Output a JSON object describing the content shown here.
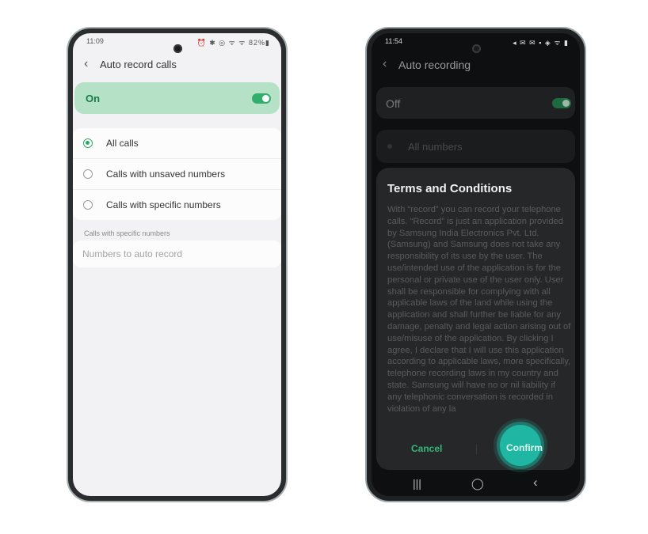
{
  "left_phone": {
    "status": {
      "time": "11:09",
      "icons": "⏰ ✱ ◎ ᯤ ᯤ 82%▮"
    },
    "title": "Auto record calls",
    "master_toggle": {
      "label": "On",
      "state": "on",
      "color": "#2faf6b"
    },
    "options": [
      {
        "label": "All calls",
        "selected": true
      },
      {
        "label": "Calls with unsaved numbers",
        "selected": false
      },
      {
        "label": "Calls with specific numbers",
        "selected": false
      }
    ],
    "section_header": "Calls with specific numbers",
    "numbers_field": {
      "placeholder": "Numbers to auto record",
      "value": ""
    }
  },
  "right_phone": {
    "status": {
      "time": "11:54",
      "icons": "◂ ✉ ✉ ▪  ◈ ᯤ ▮"
    },
    "title": "Auto recording",
    "master_toggle": {
      "label": "Off",
      "state": "on"
    },
    "background_option": "All numbers",
    "dialog": {
      "title": "Terms and Conditions",
      "body": "With “record” you can record your telephone calls. “Record” is just an application provided by Samsung India Electronics Pvt. Ltd. (Samsung) and Samsung does not take any responsibility of its use by the user. The use/intended use of the application is for the personal or private use of the user only. User shall be responsible for complying with all applicable laws of the land while using the application and shall further be liable for any damage, penalty and legal action arising out of use/misuse of the application. By clicking I agree, I declare that I will use this application according to applicable laws, more specifically, telephone recording laws in my country and state. Samsung will have no or nil liability if any telephonic conversation is recorded in violation of any la",
      "cancel_label": "Cancel",
      "confirm_label": "Confirm",
      "accent": "#34b87a"
    },
    "navbar": {
      "recents": "|||",
      "home": "◯",
      "back": "‹"
    }
  }
}
